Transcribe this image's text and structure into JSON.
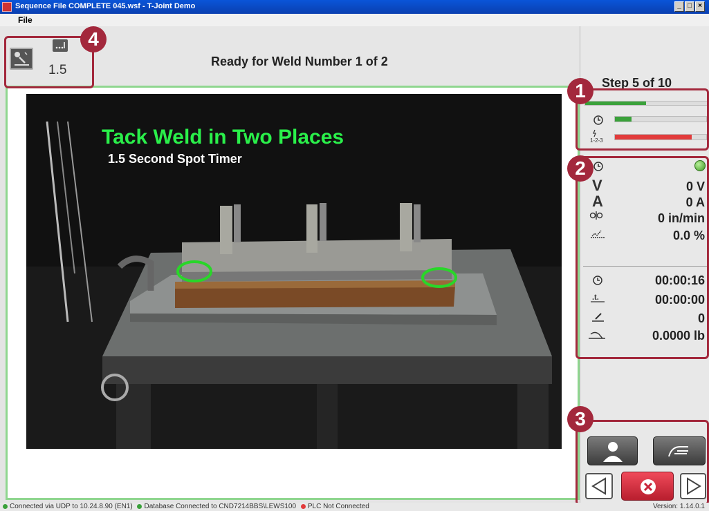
{
  "window": {
    "title": "Sequence File COMPLETE 045.wsf - T-Joint Demo",
    "controls": [
      "_",
      "□",
      "×"
    ]
  },
  "menu": {
    "file": "File"
  },
  "toolbar": {
    "spot_time": "1.5",
    "status": "Ready for Weld Number 1 of 2"
  },
  "video": {
    "heading": "Tack Weld in Two Places",
    "subheading": "1.5 Second Spot Timer"
  },
  "panel": {
    "step": "Step 5 of 10",
    "progress": {
      "step_fraction": 0.5,
      "arc_time_fraction": 0.18,
      "sequence_fraction": 0.84,
      "sequence_label": "1-2-3"
    },
    "readouts": {
      "voltage_symbol": "V",
      "voltage": "0 V",
      "current_symbol": "A",
      "current": "0 A",
      "wire_feed": "0 in/min",
      "percent": "0.0 %",
      "arc_time": "00:00:16",
      "cycle_time": "00:00:00",
      "weld_count": "0",
      "wire_weight": "0.0000 lb"
    }
  },
  "callouts": [
    "1",
    "2",
    "3",
    "4"
  ],
  "statusbar": {
    "udp": "Connected via UDP to 10.24.8.90 (EN1)",
    "database": "Database Connected to CND7214BBS\\LEWS100",
    "plc": "PLC Not Connected",
    "version": "Version: 1.14.0.1"
  },
  "colors": {
    "titlebar": "#0a55d8",
    "accent_callout": "#a3283c",
    "progress_green": "#3aa13a",
    "progress_red": "#e23b3b",
    "frame_green": "#8fd68f",
    "heading_green": "#2aef4a"
  },
  "icons": {
    "tool_button": "weld-torch-icon",
    "spot_timer": "spot-timer-icon",
    "operator": "operator-icon",
    "manual": "hand-icon",
    "previous": "triangle-left-icon",
    "stop": "x-circle-icon",
    "next": "triangle-right-icon"
  }
}
